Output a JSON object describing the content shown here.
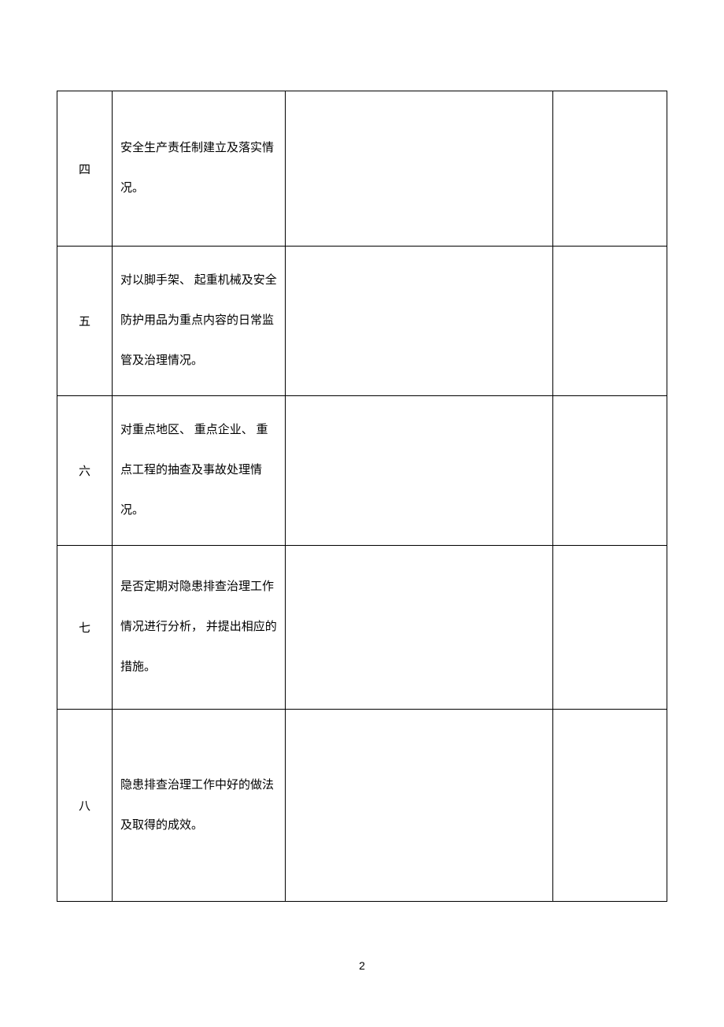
{
  "rows": [
    {
      "num": "四",
      "content": "安全生产责任制建立及落实情况。",
      "col3": "",
      "col4": ""
    },
    {
      "num": "五",
      "content": "对以脚手架、 起重机械及安全防护用品为重点内容的日常监管及治理情况。",
      "col3": "",
      "col4": ""
    },
    {
      "num": "六",
      "content": "对重点地区、 重点企业、 重点工程的抽查及事故处理情况。",
      "col3": "",
      "col4": ""
    },
    {
      "num": "七",
      "content": "是否定期对隐患排查治理工作情况进行分析， 并提出相应的措施。",
      "col3": "",
      "col4": ""
    },
    {
      "num": "八",
      "content": "隐患排查治理工作中好的做法及取得的成效。",
      "col3": "",
      "col4": ""
    }
  ],
  "pageNumber": "2"
}
